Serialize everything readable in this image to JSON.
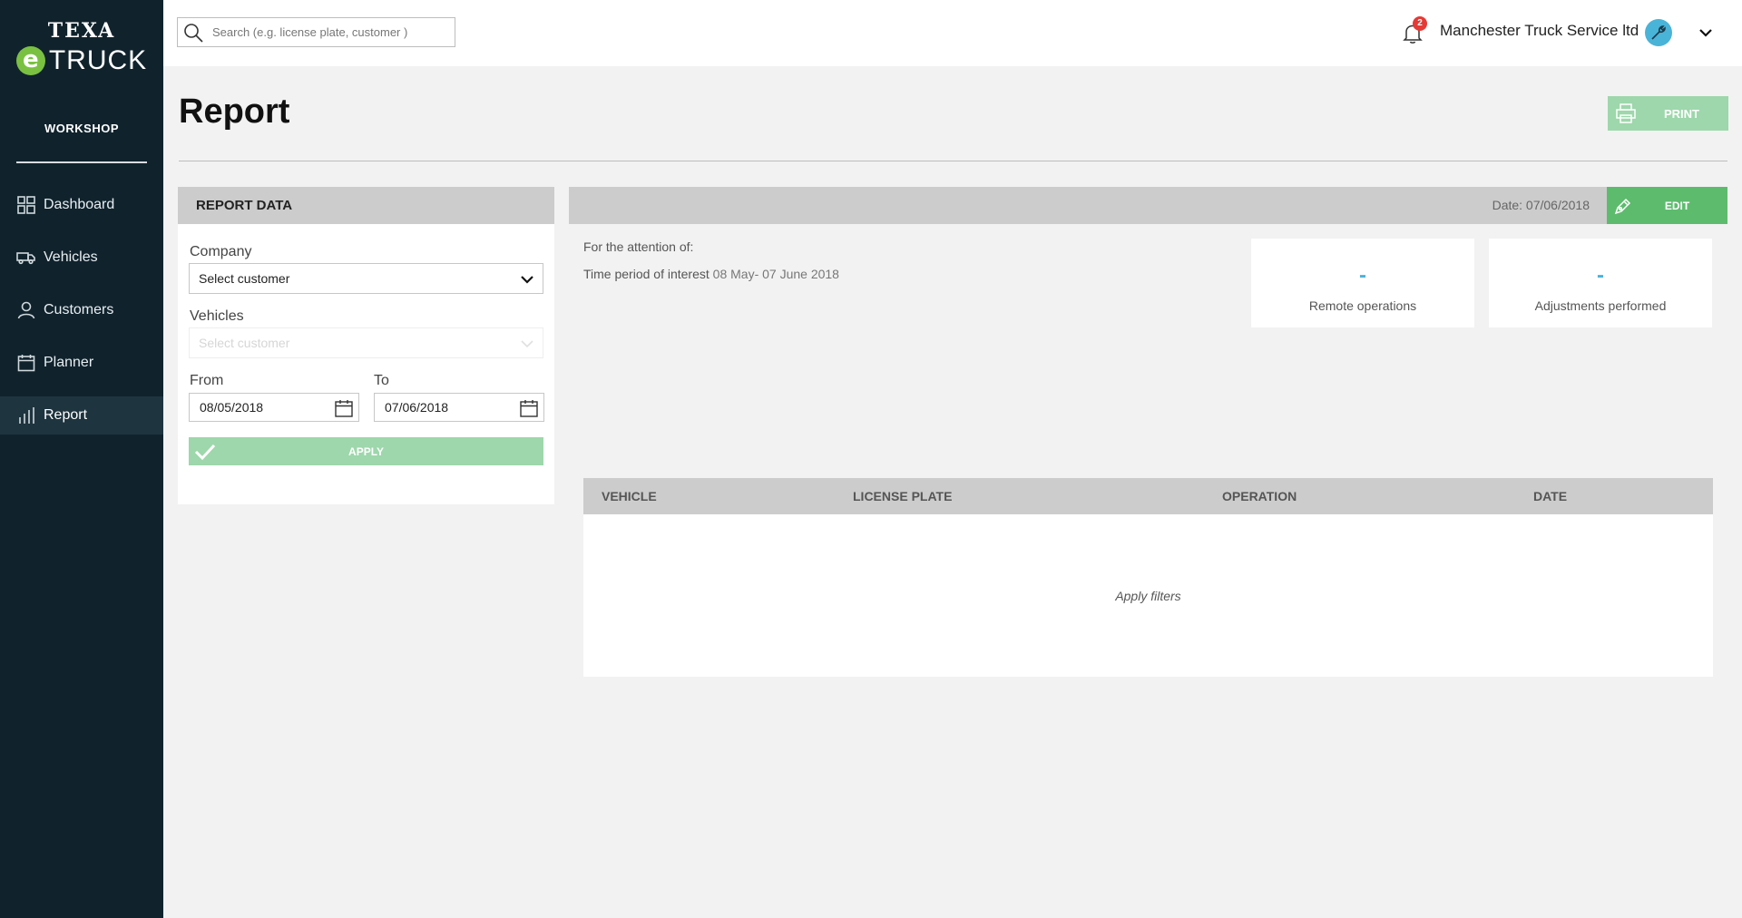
{
  "sidebar": {
    "logo_top": "TEXA",
    "logo_e": "e",
    "logo_bottom": "TRUCK",
    "section": "WORKSHOP",
    "items": [
      {
        "label": "Dashboard",
        "icon": "dashboard-grid-icon"
      },
      {
        "label": "Vehicles",
        "icon": "truck-icon"
      },
      {
        "label": "Customers",
        "icon": "person-icon"
      },
      {
        "label": "Planner",
        "icon": "calendar-icon"
      },
      {
        "label": "Report",
        "icon": "bar-chart-icon",
        "active": true
      }
    ]
  },
  "topbar": {
    "search_placeholder": "Search (e.g. license plate, customer )",
    "notification_count": "2",
    "company_name": "Manchester Truck Service ltd"
  },
  "page": {
    "title": "Report",
    "print_label": "PRINT"
  },
  "report_data": {
    "header": "REPORT DATA",
    "company_label": "Company",
    "company_value": "Select customer",
    "vehicles_label": "Vehicles",
    "vehicles_value": "Select customer",
    "from_label": "From",
    "from_value": "08/05/2018",
    "to_label": "To",
    "to_value": "07/06/2018",
    "apply_label": "APPLY"
  },
  "report": {
    "date_text": "Date: 07/06/2018",
    "edit_label": "EDIT",
    "attention_label": "For the attention of:",
    "period_label": "Time period of interest",
    "period_value": "08 May- 07 June 2018",
    "stats": [
      {
        "value": "-",
        "label": "Remote operations"
      },
      {
        "value": "-",
        "label": "Adjustments performed"
      }
    ]
  },
  "table": {
    "columns": [
      "VEHICLE",
      "LICENSE PLATE",
      "OPERATION",
      "DATE"
    ],
    "empty_message": "Apply filters"
  },
  "colors": {
    "sidebar_bg": "#10232d",
    "accent_green": "#5dbb6e",
    "light_green": "#9dd7ab",
    "accent_blue": "#4ab3d8",
    "badge_red": "#e53935"
  }
}
